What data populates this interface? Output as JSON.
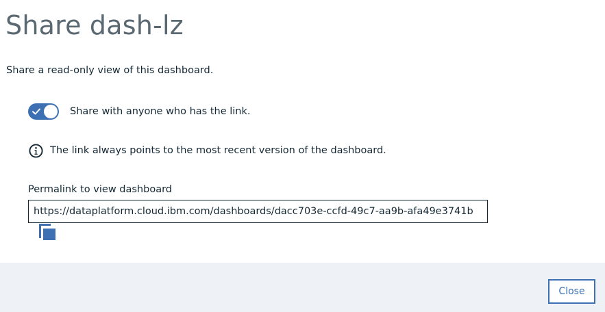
{
  "dialog": {
    "title": "Share dash-lz",
    "subtitle": "Share a read-only view of this dashboard."
  },
  "share_toggle": {
    "label": "Share with anyone who has the link.",
    "checked": true,
    "color": "#3d70b2"
  },
  "info": {
    "icon": "info-icon",
    "text": "The link always points to the most recent version of the dashboard."
  },
  "permalink": {
    "label": "Permalink to view dashboard",
    "value": "https://dataplatform.cloud.ibm.com/dashboards/dacc703e-ccfd-49c7-aa9b-afa49e3741b",
    "copy_icon": "copy-icon"
  },
  "footer": {
    "close_label": "Close"
  },
  "colors": {
    "accent": "#3d70b2",
    "text": "#152935",
    "title": "#5a6872",
    "footer_bg": "#eef1f5"
  }
}
